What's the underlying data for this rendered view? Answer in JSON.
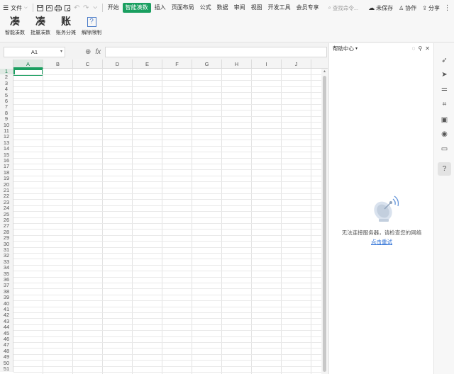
{
  "menubar": {
    "menu_icon": "hamburger-icon",
    "file_label": "文件",
    "tabs": [
      "开始",
      "智能凑数",
      "插入",
      "页面布局",
      "公式",
      "数据",
      "审阅",
      "视图",
      "开发工具",
      "会员专享"
    ],
    "active_tab": "智能凑数",
    "search_placeholder": "查找命令...",
    "unsaved_label": "未保存",
    "collab_label": "协作",
    "share_label": "分享"
  },
  "ribbon": {
    "buttons": [
      {
        "glyph": "凑",
        "label": "智能凑数"
      },
      {
        "glyph": "凑",
        "label": "批量凑数"
      },
      {
        "glyph": "账",
        "label": "账务分摊"
      },
      {
        "glyph": "?",
        "label": "解除限制"
      }
    ]
  },
  "formula_bar": {
    "cell_ref": "A1",
    "fx_label": "fx",
    "formula_value": ""
  },
  "grid": {
    "columns": [
      "A",
      "B",
      "C",
      "D",
      "E",
      "F",
      "G",
      "H",
      "I",
      "J"
    ],
    "rows": [
      "1",
      "2",
      "3",
      "4",
      "5",
      "6",
      "7",
      "8",
      "9",
      "10",
      "11",
      "12",
      "13",
      "14",
      "15",
      "16",
      "17",
      "18",
      "19",
      "20",
      "21",
      "22",
      "23",
      "24",
      "25",
      "26",
      "27",
      "28",
      "29",
      "30",
      "31",
      "32",
      "33",
      "34",
      "35",
      "36",
      "37",
      "38",
      "39",
      "40",
      "41",
      "42",
      "43",
      "44",
      "45",
      "46",
      "47",
      "48",
      "49",
      "50",
      "51"
    ],
    "selected_column": "A",
    "selected_row": "1"
  },
  "help_panel": {
    "title": "帮助中心",
    "message": "无法连接服务器，请检查您的网络",
    "retry_label": "点击重试"
  },
  "colors": {
    "accent": "#1a9f60",
    "link": "#2b6fd6"
  }
}
